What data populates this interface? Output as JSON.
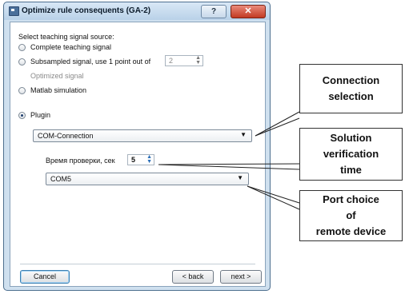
{
  "window": {
    "title": "Optimize rule consequents (GA-2)",
    "help_label": "?",
    "close_label": "✕"
  },
  "source": {
    "heading": "Select teaching signal source:",
    "options": [
      {
        "label": "Complete teaching signal",
        "selected": false,
        "enabled": true
      },
      {
        "label": "Subsampled signal, use 1 point out of",
        "selected": false,
        "enabled": true
      },
      {
        "label": "Optimized signal",
        "selected": false,
        "enabled": false
      },
      {
        "label": "Matlab simulation",
        "selected": false,
        "enabled": true
      },
      {
        "label": "Plugin",
        "selected": true,
        "enabled": true
      }
    ],
    "subsample_value": "2"
  },
  "plugin": {
    "connection_value": "COM-Connection",
    "check_time_label": "Время проверки, сек",
    "check_time_value": "5",
    "port_value": "COM5"
  },
  "buttons": {
    "cancel": "Cancel",
    "back": "< back",
    "next": "next >"
  },
  "callouts": {
    "connection": [
      "Connection",
      "selection"
    ],
    "verification": [
      "Solution",
      "verification",
      "time"
    ],
    "port": [
      "Port choice",
      "of",
      "remote device"
    ]
  },
  "colors": {
    "window_border": "#4d6f8f",
    "titlebar": "#c6dbef",
    "close_button": "#c23a22"
  }
}
